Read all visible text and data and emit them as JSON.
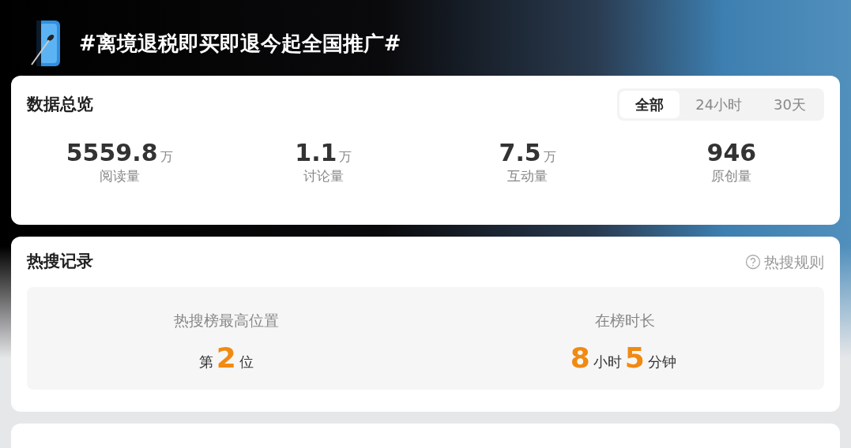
{
  "topic": {
    "title": "#离境退税即买即退今起全国推广#"
  },
  "overview": {
    "title": "数据总览",
    "tabs": [
      {
        "label": "全部",
        "selected": true
      },
      {
        "label": "24小时",
        "selected": false
      },
      {
        "label": "30天",
        "selected": false
      }
    ],
    "stats": [
      {
        "value": "5559.8",
        "unit": "万",
        "label": "阅读量"
      },
      {
        "value": "1.1",
        "unit": "万",
        "label": "讨论量"
      },
      {
        "value": "7.5",
        "unit": "万",
        "label": "互动量"
      },
      {
        "value": "946",
        "label": "原创量"
      }
    ]
  },
  "hot_search": {
    "title": "热搜记录",
    "rules_link": "热搜规则",
    "peak": {
      "label": "热搜榜最高位置",
      "parts": [
        {
          "kind": "unit",
          "text": "第"
        },
        {
          "kind": "number",
          "text": "2"
        },
        {
          "kind": "unit",
          "text": "位"
        }
      ]
    },
    "duration": {
      "label": "在榜时长",
      "parts": [
        {
          "kind": "number",
          "text": "8"
        },
        {
          "kind": "unit",
          "text": "小时"
        },
        {
          "kind": "number",
          "text": "5"
        },
        {
          "kind": "unit",
          "text": "分钟"
        }
      ]
    }
  }
}
